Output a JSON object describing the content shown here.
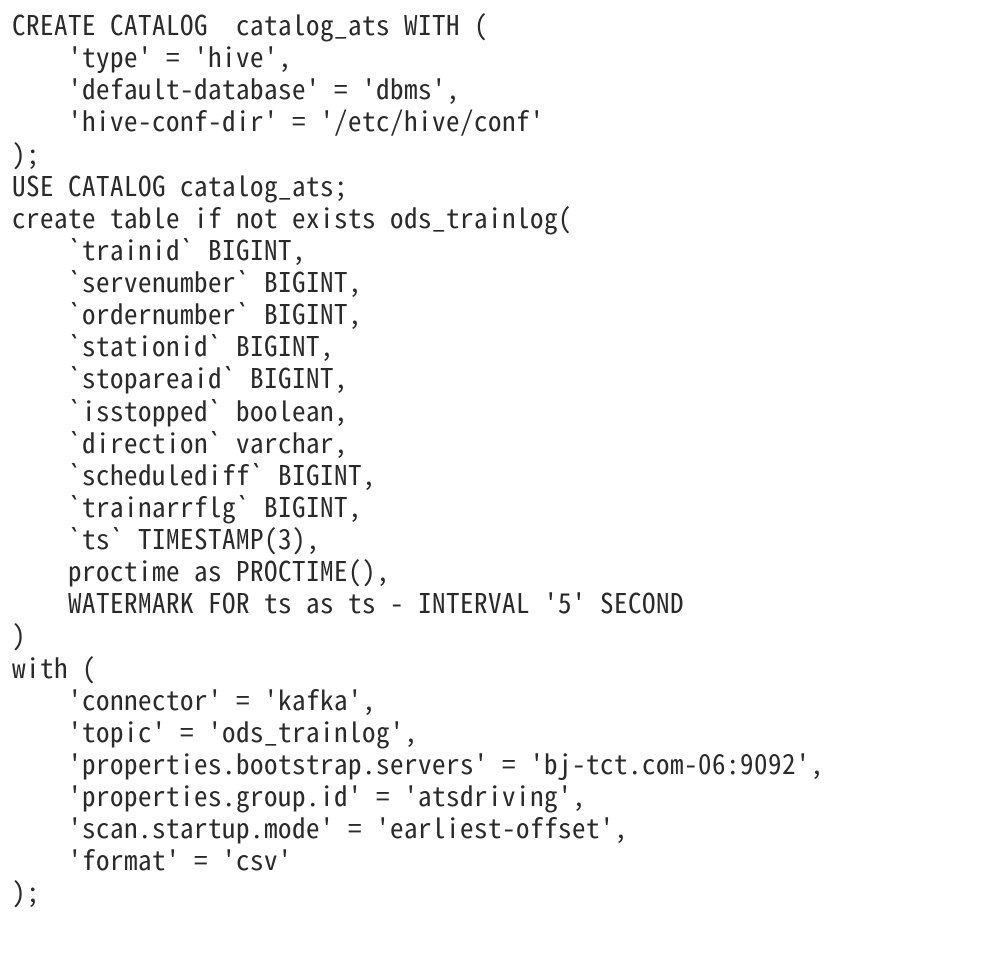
{
  "code": {
    "lines": [
      "CREATE CATALOG  catalog_ats WITH (",
      "    'type' = 'hive',",
      "    'default-database' = 'dbms',",
      "    'hive-conf-dir' = '/etc/hive/conf'",
      ");",
      "USE CATALOG catalog_ats;",
      "create table if not exists ods_trainlog(",
      "    `trainid` BIGINT,",
      "    `servenumber` BIGINT,",
      "    `ordernumber` BIGINT,",
      "    `stationid` BIGINT,",
      "    `stopareaid` BIGINT,",
      "    `isstopped` boolean,",
      "    `direction` varchar,",
      "    `schedulediff` BIGINT,",
      "    `trainarrflg` BIGINT,",
      "    `ts` TIMESTAMP(3),",
      "    proctime as PROCTIME(),",
      "    WATERMARK FOR ts as ts - INTERVAL '5' SECOND",
      ")",
      "with (",
      "    'connector' = 'kafka',",
      "    'topic' = 'ods_trainlog',",
      "    'properties.bootstrap.servers' = 'bj-tct.com-06:9092',",
      "    'properties.group.id' = 'atsdriving',",
      "    'scan.startup.mode' = 'earliest-offset',",
      "    'format' = 'csv'",
      ");"
    ]
  }
}
